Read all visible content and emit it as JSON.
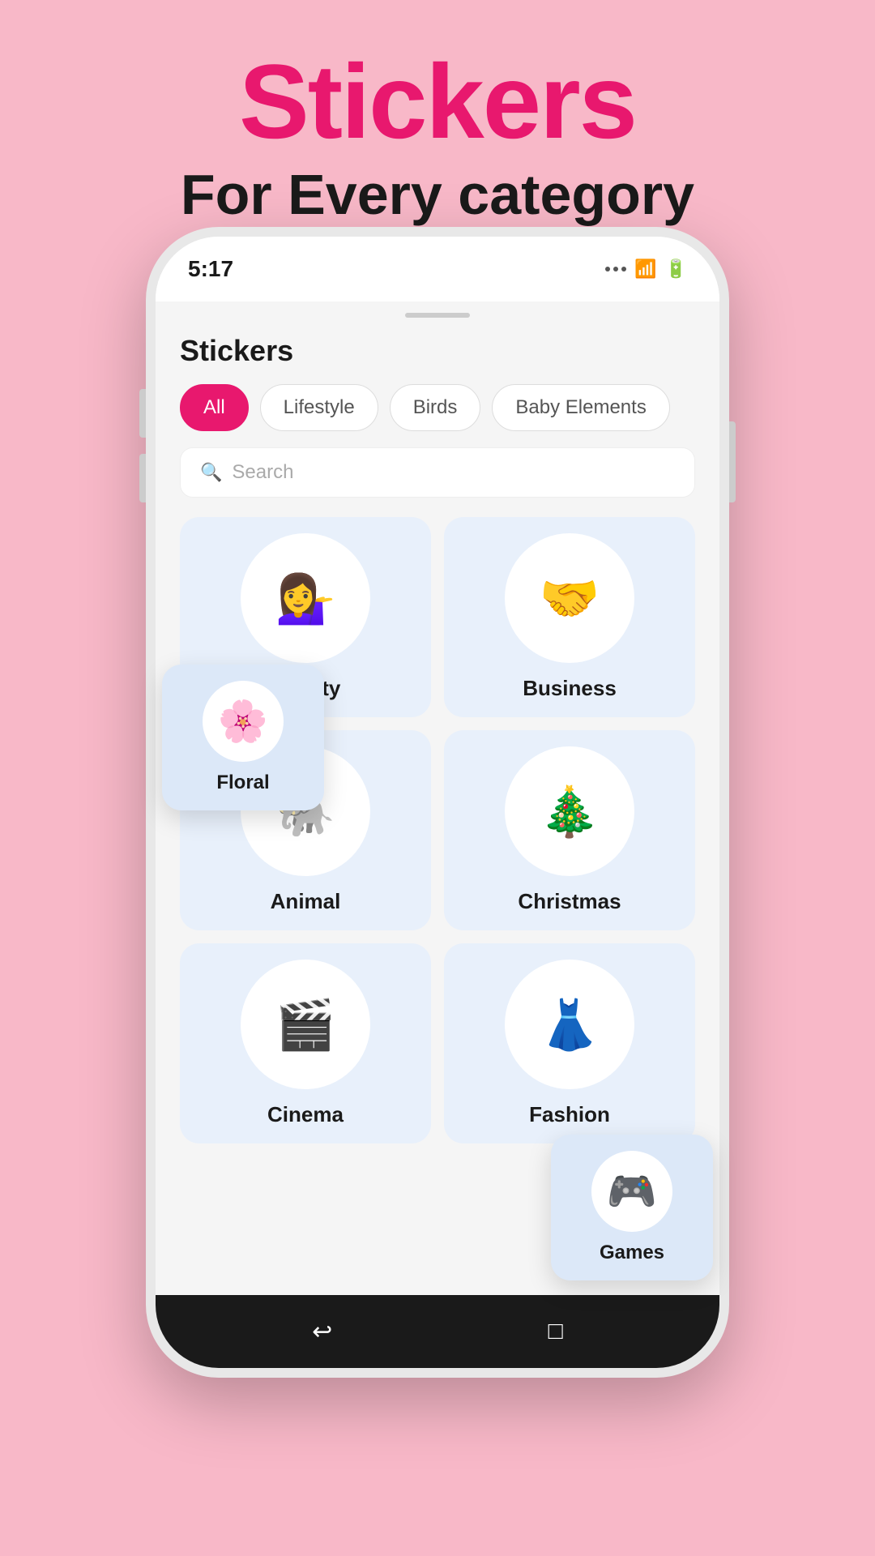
{
  "header": {
    "title": "Stickers",
    "subtitle": "For Every category"
  },
  "phone": {
    "status_time": "5:17",
    "scroll_indicator": true
  },
  "app": {
    "title": "Stickers",
    "search_placeholder": "Search"
  },
  "filters": [
    {
      "id": "all",
      "label": "All",
      "active": true
    },
    {
      "id": "lifestyle",
      "label": "Lifestyle",
      "active": false
    },
    {
      "id": "birds",
      "label": "Birds",
      "active": false
    },
    {
      "id": "baby",
      "label": "Baby Elements",
      "active": false
    }
  ],
  "sticker_categories": [
    {
      "id": "beauty",
      "label": "Beauty",
      "emoji": "💆"
    },
    {
      "id": "business",
      "label": "Business",
      "emoji": "🤝"
    },
    {
      "id": "animal",
      "label": "Animal",
      "emoji": "🐘"
    },
    {
      "id": "christmas",
      "label": "Christmas",
      "emoji": "🎄"
    },
    {
      "id": "cinema",
      "label": "Cinema",
      "emoji": "🎬"
    },
    {
      "id": "fashion",
      "label": "Fashion",
      "emoji": "👗"
    }
  ],
  "floating_cards": {
    "floral": {
      "label": "Floral",
      "emoji": "🌸"
    },
    "games": {
      "label": "Games",
      "emoji": "🎮"
    }
  },
  "bottom_nav": {
    "items": [
      "←",
      "□"
    ]
  }
}
